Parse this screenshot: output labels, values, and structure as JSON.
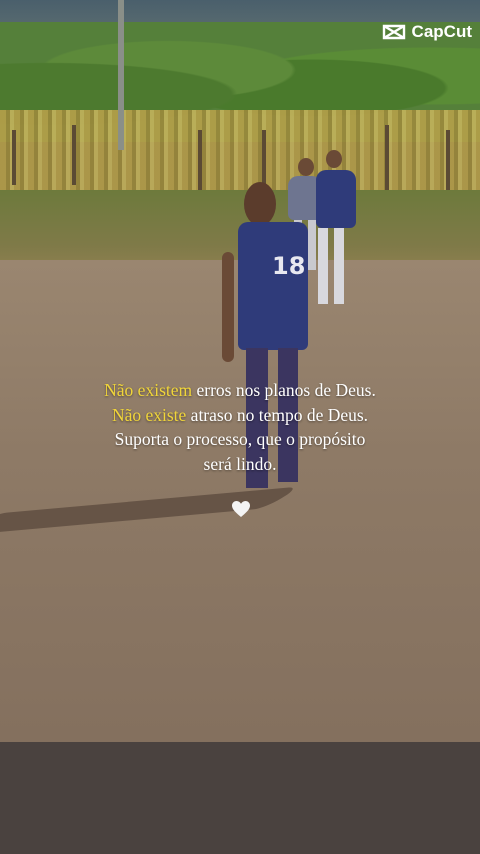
{
  "watermark": {
    "brand": "CapCut",
    "icon": "capcut-logo-icon"
  },
  "caption": {
    "line1_highlight": "Não existem",
    "line1_rest": " erros nos planos de Deus.",
    "line2_highlight": "Não existe",
    "line2_rest": " atraso no tempo de Deus.",
    "line3": "Suporta o processo, que o propósito",
    "line4": "será lindo."
  },
  "jersey_number": "18",
  "heart": {
    "icon": "white-heart-icon",
    "color": "#f4f4f4"
  },
  "colors": {
    "highlight": "#f0d53a",
    "caption_text": "#ffffff",
    "lower_panel": "#4a423f"
  }
}
